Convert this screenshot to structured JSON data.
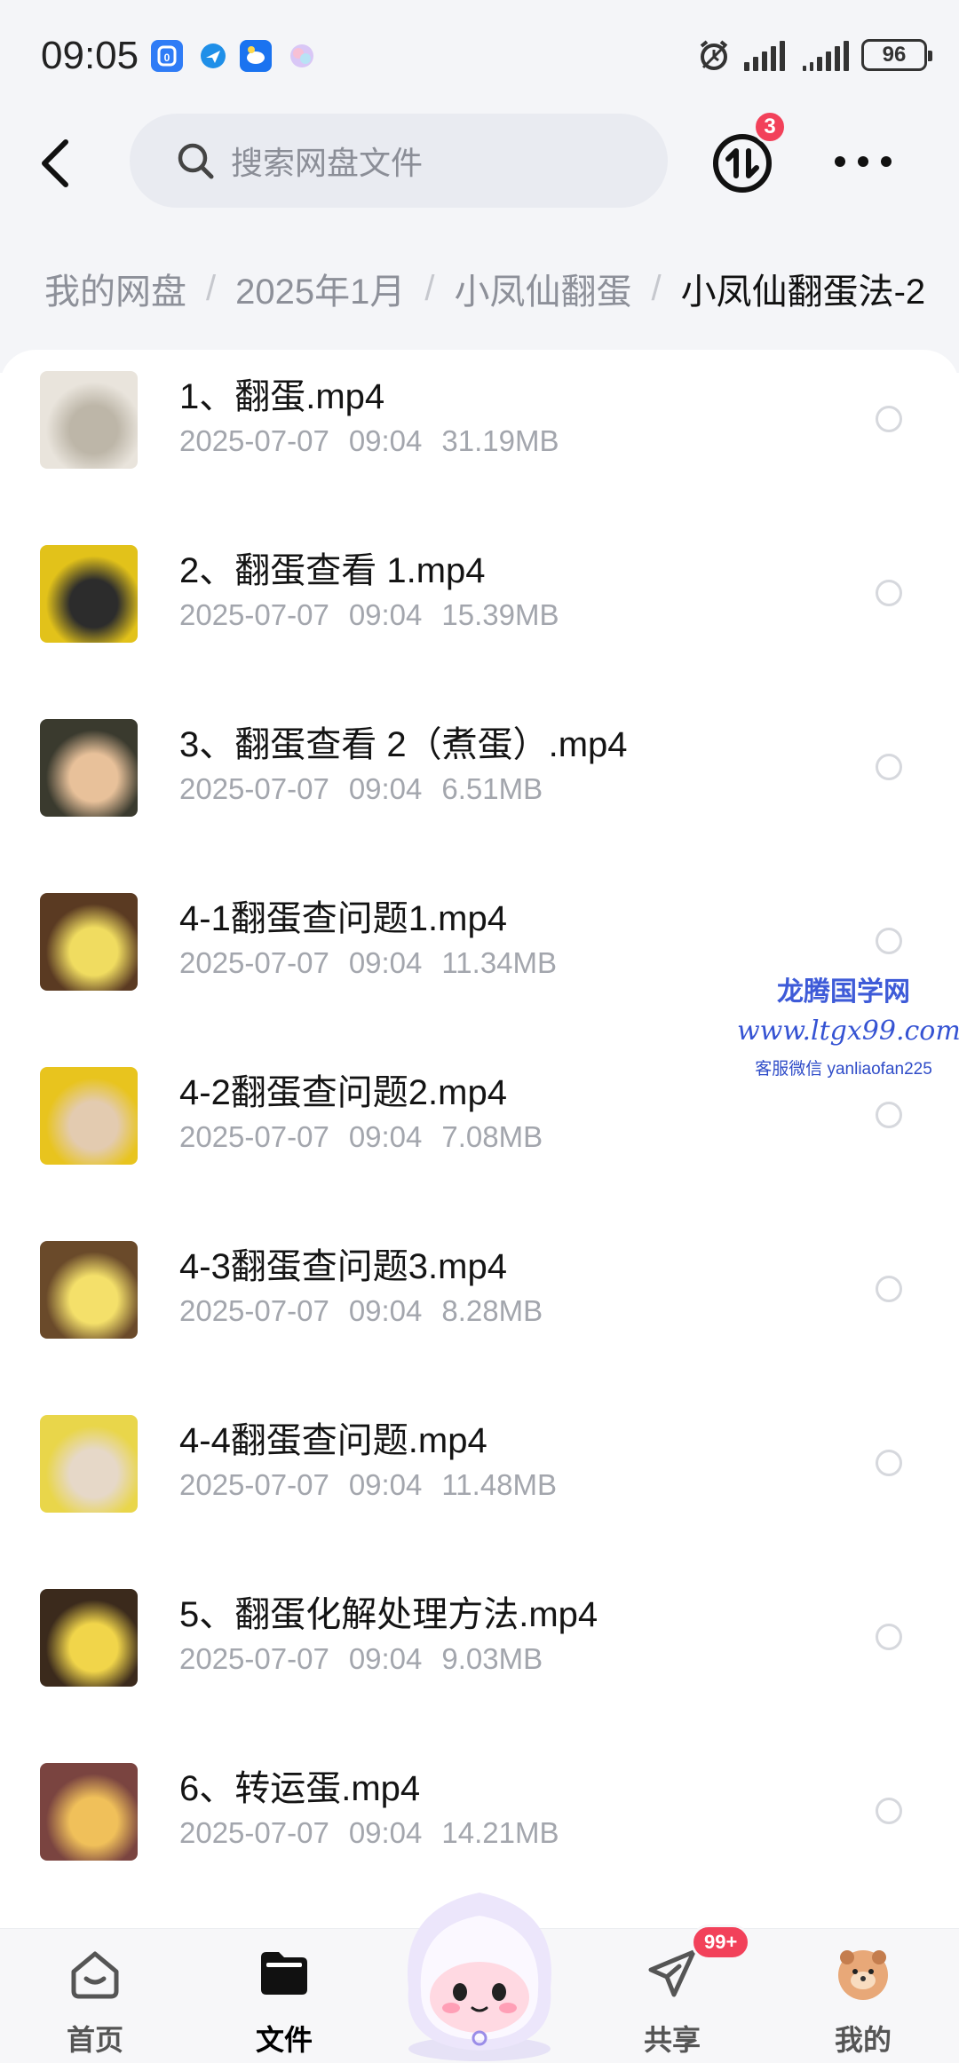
{
  "status": {
    "time": "09:05",
    "battery": "96",
    "app_icon_colors": [
      "#2f7cf6",
      "#1f8fe8",
      "#1a73f0",
      "#c9b6f2"
    ]
  },
  "header": {
    "search_placeholder": "搜索网盘文件",
    "transfer_badge": "3",
    "icons": [
      "chevron-left-icon",
      "search-icon",
      "transfer-icon",
      "more-dots-icon"
    ]
  },
  "breadcrumb": {
    "items": [
      "我的网盘",
      "2025年1月",
      "小凤仙翻蛋",
      "小凤仙翻蛋法-2"
    ],
    "separator": "/"
  },
  "files": [
    {
      "name": "1、翻蛋.mp4",
      "date": "2025-07-07",
      "time": "09:04",
      "size": "31.19MB",
      "thumb_colors": [
        "#e9e4dc",
        "#bdb6a8"
      ]
    },
    {
      "name": "2、翻蛋查看 1.mp4",
      "date": "2025-07-07",
      "time": "09:04",
      "size": "15.39MB",
      "thumb_colors": [
        "#e2c21a",
        "#2c2c2c"
      ]
    },
    {
      "name": "3、翻蛋查看 2（煮蛋）.mp4",
      "date": "2025-07-07",
      "time": "09:04",
      "size": "6.51MB",
      "thumb_colors": [
        "#3a3a2e",
        "#e8c19a"
      ]
    },
    {
      "name": "4-1翻蛋查问题1.mp4",
      "date": "2025-07-07",
      "time": "09:04",
      "size": "11.34MB",
      "thumb_colors": [
        "#5a3a22",
        "#f0dc60"
      ]
    },
    {
      "name": "4-2翻蛋查问题2.mp4",
      "date": "2025-07-07",
      "time": "09:04",
      "size": "7.08MB",
      "thumb_colors": [
        "#e8c41e",
        "#e3cbb0"
      ]
    },
    {
      "name": "4-3翻蛋查问题3.mp4",
      "date": "2025-07-07",
      "time": "09:04",
      "size": "8.28MB",
      "thumb_colors": [
        "#6a4a2a",
        "#f4e06a"
      ]
    },
    {
      "name": "4-4翻蛋查问题.mp4",
      "date": "2025-07-07",
      "time": "09:04",
      "size": "11.48MB",
      "thumb_colors": [
        "#e9d64a",
        "#e6d8c8"
      ]
    },
    {
      "name": "5、翻蛋化解处理方法.mp4",
      "date": "2025-07-07",
      "time": "09:04",
      "size": "9.03MB",
      "thumb_colors": [
        "#3b2a1c",
        "#f1d54a"
      ]
    },
    {
      "name": "6、转运蛋.mp4",
      "date": "2025-07-07",
      "time": "09:04",
      "size": "14.21MB",
      "thumb_colors": [
        "#7a4440",
        "#f0c05a"
      ]
    }
  ],
  "watermark": {
    "line1": "龙腾国学网",
    "line2": "www.ltgx99.com",
    "line3": "客服微信 yanliaofan225"
  },
  "tabs": [
    {
      "label": "首页",
      "icon": "home-icon",
      "active": false
    },
    {
      "label": "文件",
      "icon": "folder-icon",
      "active": true
    },
    {
      "label": "共享",
      "icon": "paper-plane-icon",
      "active": false
    },
    {
      "label": "我的",
      "icon": "avatar-icon",
      "active": false
    }
  ],
  "share_badge": "99+",
  "accent_color": "#f2415a"
}
